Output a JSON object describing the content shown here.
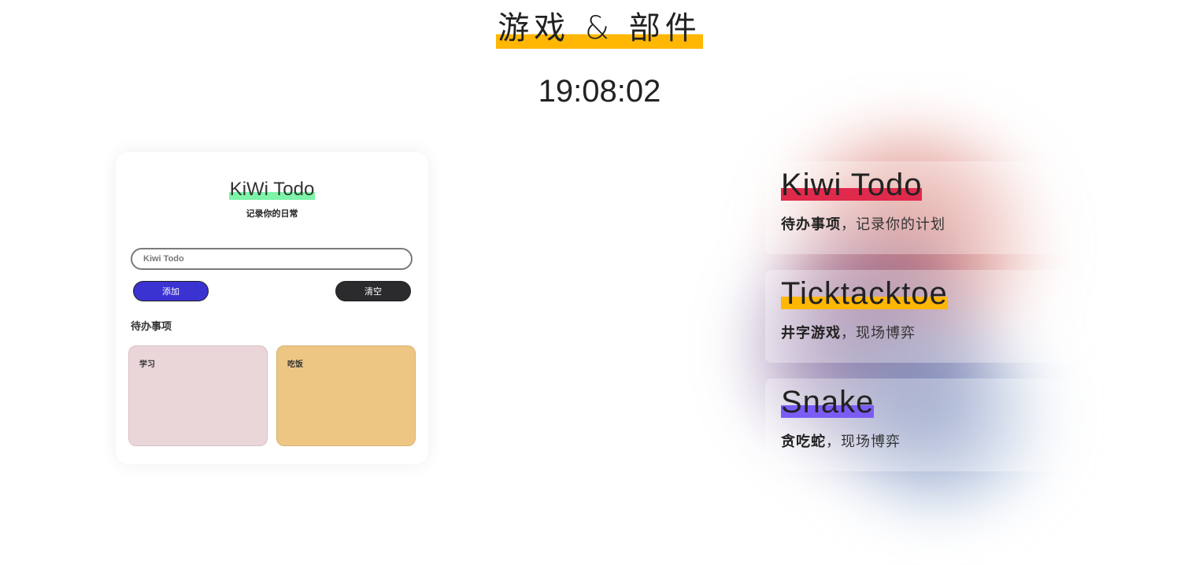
{
  "header": {
    "title": "游戏 & 部件",
    "clock": "19:08:02"
  },
  "todo": {
    "title": "KiWi Todo",
    "subtitle": "记录你的日常",
    "input_placeholder": "Kiwi Todo",
    "add_label": "添加",
    "clear_label": "清空",
    "section_title": "待办事项",
    "notes": [
      {
        "text": "学习",
        "color": "#ead5d8"
      },
      {
        "text": "吃饭",
        "color": "#edc684"
      }
    ],
    "accent_color": "#7ef4a9",
    "add_button_color": "#3b33d1",
    "clear_button_color": "#2b2b2e"
  },
  "features": [
    {
      "title": "Kiwi Todo",
      "desc_bold": "待办事项",
      "desc": "，记录你的计划",
      "highlight_color": "#e02a4b"
    },
    {
      "title": "Ticktacktoe",
      "desc_bold": "井字游戏",
      "desc": "，现场博弈",
      "highlight_color": "#ffb703"
    },
    {
      "title": "Snake",
      "desc_bold": "贪吃蛇",
      "desc": "，现场博弈",
      "highlight_color": "#7a5cf5"
    }
  ],
  "title_highlight_color": "#ffb703"
}
